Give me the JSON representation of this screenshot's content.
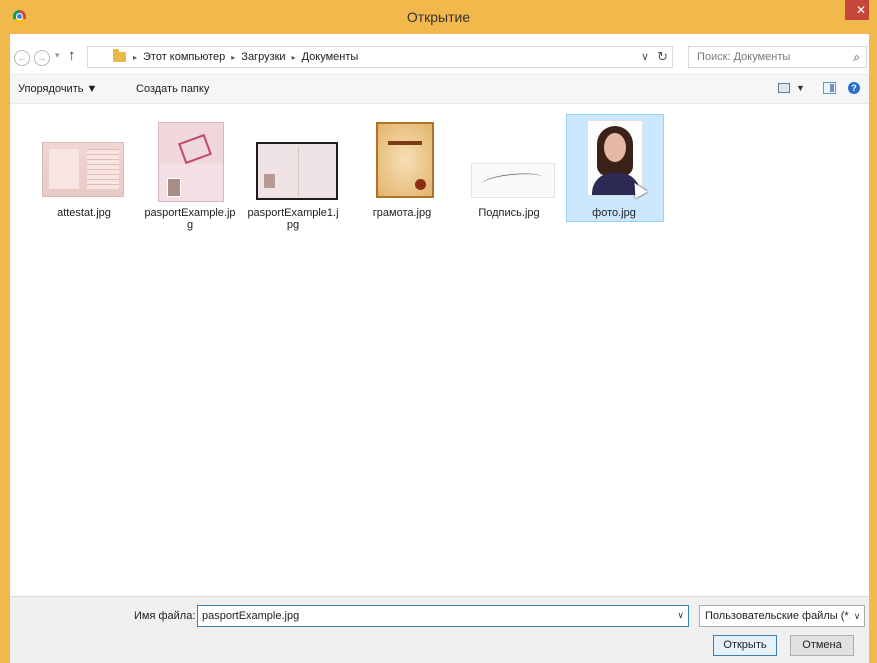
{
  "window": {
    "title": "Открытие",
    "close_glyph": "✕",
    "app_icon": "chrome-icon"
  },
  "address": {
    "back_glyph": "←",
    "forward_glyph": "→",
    "recent_glyph": "▾",
    "up_glyph": "↑",
    "crumbs": [
      "Этот компьютер",
      "Загрузки",
      "Документы"
    ],
    "crumb_separator": "▸",
    "chevron_glyph": "∨",
    "refresh_glyph": "↻"
  },
  "search": {
    "placeholder": "Поиск: Документы",
    "icon_glyph": "⌕"
  },
  "toolbar": {
    "organize_label": "Упорядочить ▼",
    "new_folder_label": "Создать папку",
    "views_drop_glyph": "▼",
    "help_glyph": "?"
  },
  "files": [
    {
      "name": "attestat.jpg",
      "selected": false
    },
    {
      "name": "pasportExample.jpg",
      "selected": false
    },
    {
      "name": "pasportExample1.jpg",
      "selected": false
    },
    {
      "name": "грамота.jpg",
      "selected": false
    },
    {
      "name": "Подпись.jpg",
      "selected": false
    },
    {
      "name": "фото.jpg",
      "selected": true
    }
  ],
  "footer": {
    "filename_label": "Имя файла:",
    "filename_value": "pasportExample.jpg",
    "filename_drop_glyph": "∨",
    "filetype_value": "Пользовательские файлы (*.p",
    "filetype_drop_glyph": "∨",
    "open_label": "Открыть",
    "cancel_label": "Отмена"
  },
  "colors": {
    "frame": "#f1b94b",
    "selection": "#cce8ff",
    "close": "#c7463a"
  }
}
